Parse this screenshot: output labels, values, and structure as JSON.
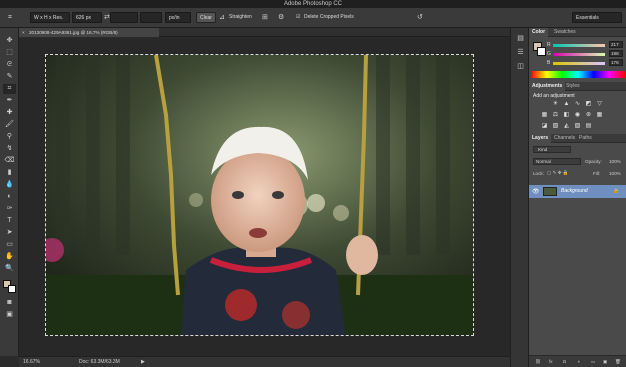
{
  "app": {
    "title": "Adobe Photoshop CC"
  },
  "options_bar": {
    "ratio_select": "W x H x Res.",
    "field_1": "626 px",
    "field_2": "",
    "unit_select": "px/in",
    "clear_label": "Clear",
    "straighten_label": "Straighten",
    "delete_cropped_label": "Delete Cropped Pixels",
    "delete_cropped_checked": true,
    "workspace_select": "Essentials"
  },
  "document": {
    "tab_label": "20130908-429A9361.jpg @ 16.7% (RGB/8)",
    "close_glyph": "×"
  },
  "status": {
    "zoom": "16.67%",
    "doc_info": "Doc: 63.3M/63.3M"
  },
  "panels": {
    "color": {
      "tabs": [
        "Color",
        "Swatches"
      ],
      "sliders": [
        {
          "label": "R",
          "value": "217"
        },
        {
          "label": "G",
          "value": "198"
        },
        {
          "label": "B",
          "value": "176"
        }
      ]
    },
    "adjustments": {
      "tabs": [
        "Adjustments",
        "Styles"
      ],
      "heading": "Add an adjustment",
      "icons_row1": [
        "brightness-icon",
        "levels-icon",
        "curves-icon",
        "exposure-icon"
      ],
      "icons_row2": [
        "vibrance-icon",
        "hue-saturation-icon",
        "color-balance-icon",
        "black-white-icon",
        "photo-filter-icon",
        "channel-mixer-icon",
        "color-lookup-icon"
      ],
      "icons_row3": [
        "invert-icon",
        "posterize-icon",
        "threshold-icon",
        "selective-color-icon",
        "gradient-map-icon"
      ]
    },
    "layers": {
      "tabs": [
        "Layers",
        "Channels",
        "Paths"
      ],
      "kind_select": "Kind",
      "blend_mode": "Normal",
      "opacity_label": "Opacity:",
      "opacity_value": "100%",
      "lock_label": "Lock:",
      "fill_label": "Fill:",
      "fill_value": "100%",
      "layer_name": "Background"
    }
  },
  "colors": {
    "foreground": "#d9c6b0",
    "background": "#ffffff",
    "accent": "#6e8fbf"
  }
}
